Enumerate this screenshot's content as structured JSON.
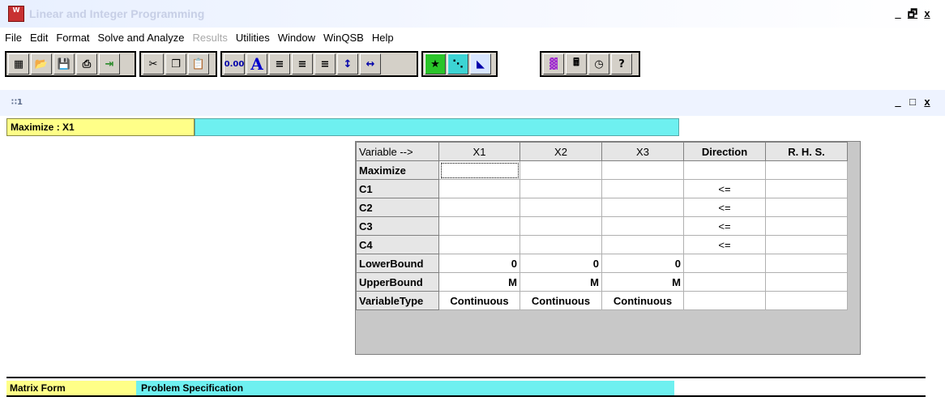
{
  "app": {
    "title": "Linear and Integer Programming",
    "icon": "winqsb-app-icon"
  },
  "window_buttons": {
    "minimize": "_",
    "maximize": "̅",
    "close": "x"
  },
  "menu": [
    "File",
    "Edit",
    "Format",
    "Solve and Analyze",
    "Results",
    "Utilities",
    "Window",
    "WinQSB",
    "Help"
  ],
  "menu_disabled": [
    "Results"
  ],
  "toolbar": {
    "groups": [
      [
        "new-icon",
        "open-icon",
        "save-icon",
        "print-icon",
        "exit-icon"
      ],
      [
        "cut-icon",
        "copy-icon",
        "paste-icon"
      ],
      [
        "number-format-icon",
        "font-icon",
        "align-left-icon",
        "align-center-icon",
        "align-right-icon",
        "row-height-icon",
        "column-width-icon"
      ],
      [
        "solve-icon",
        "graph-icon",
        "graphic-method-icon"
      ],
      [
        "chart-icon",
        "calculator-icon",
        "clock-icon",
        "help-icon"
      ]
    ]
  },
  "child_window": {
    "title": "1",
    "icon": "spreadsheet-icon"
  },
  "formula_bar": {
    "cell_label": "Maximize : X1",
    "cell_value": ""
  },
  "grid": {
    "header": [
      "Variable -->",
      "X1",
      "X2",
      "X3",
      "Direction",
      "R. H. S."
    ],
    "rows": [
      {
        "label": "Maximize",
        "cells": [
          "",
          "",
          ""
        ],
        "direction": "",
        "rhs": ""
      },
      {
        "label": "C1",
        "cells": [
          "",
          "",
          ""
        ],
        "direction": "<=",
        "rhs": ""
      },
      {
        "label": "C2",
        "cells": [
          "",
          "",
          ""
        ],
        "direction": "<=",
        "rhs": ""
      },
      {
        "label": "C3",
        "cells": [
          "",
          "",
          ""
        ],
        "direction": "<=",
        "rhs": ""
      },
      {
        "label": "C4",
        "cells": [
          "",
          "",
          ""
        ],
        "direction": "<=",
        "rhs": ""
      },
      {
        "label": "LowerBound",
        "cells": [
          "0",
          "0",
          "0"
        ],
        "direction": "",
        "rhs": ""
      },
      {
        "label": "UpperBound",
        "cells": [
          "M",
          "M",
          "M"
        ],
        "direction": "",
        "rhs": ""
      },
      {
        "label": "VariableType",
        "cells": [
          "Continuous",
          "Continuous",
          "Continuous"
        ],
        "direction": "",
        "rhs": ""
      }
    ]
  },
  "status": {
    "left": "Matrix Form",
    "right": "Problem Specification"
  },
  "colors": {
    "yellow": "#ffff88",
    "cyan": "#6ef0f0",
    "toolbar": "#d4d0c8"
  }
}
